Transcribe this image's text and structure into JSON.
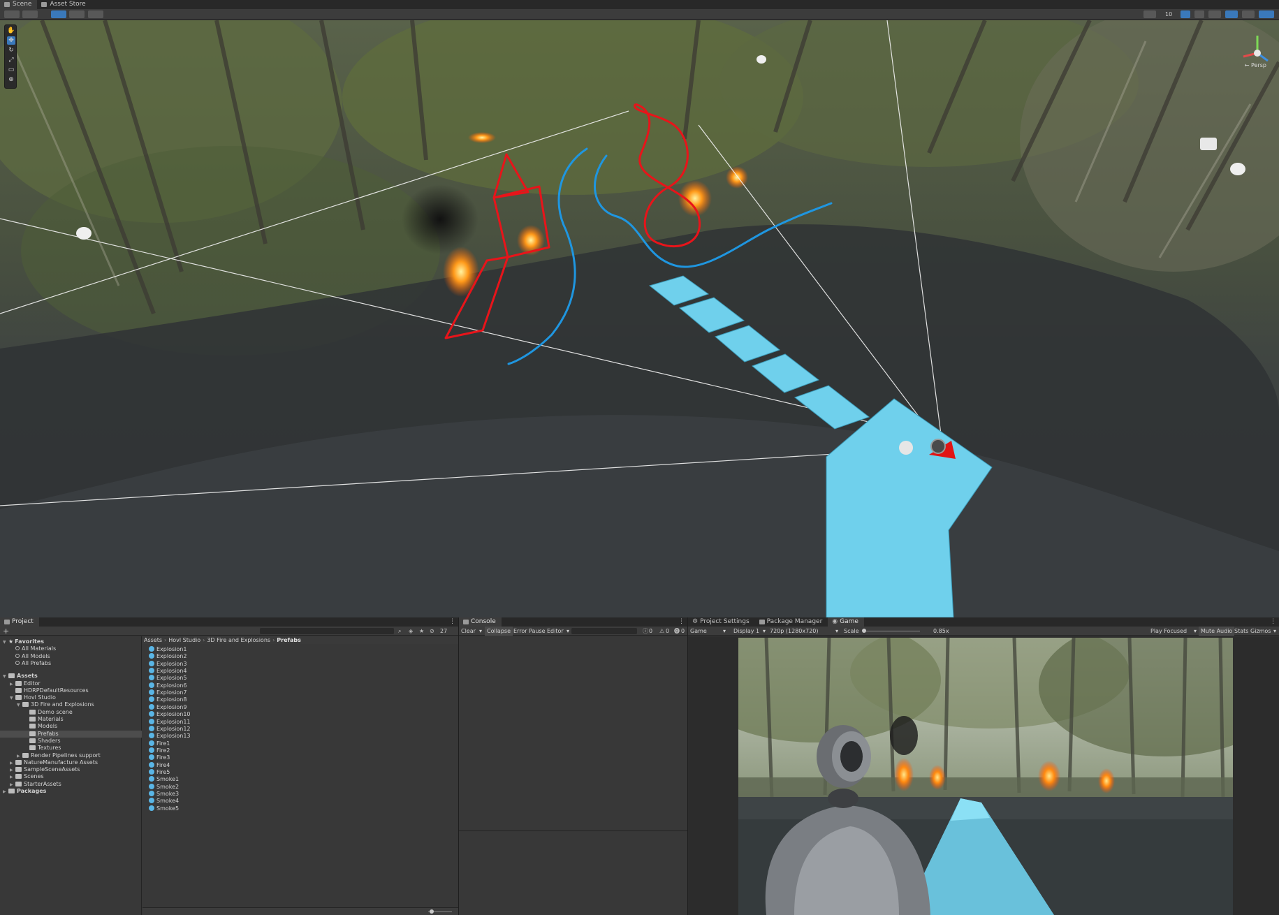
{
  "top_tabs": [
    {
      "label": "Scene",
      "icon": "scene-icon"
    },
    {
      "label": "Asset Store",
      "icon": "store-icon"
    }
  ],
  "scene": {
    "gizmo_label": "← Persp",
    "toolbar_number": "10"
  },
  "project": {
    "tab_label": "Project",
    "add_label": "+",
    "hidden_count": "27",
    "tree": [
      {
        "label": "Favorites",
        "level": 0,
        "bold": true,
        "kind": "star",
        "fold": "▼"
      },
      {
        "label": "All Materials",
        "level": 1,
        "kind": "search"
      },
      {
        "label": "All Models",
        "level": 1,
        "kind": "search"
      },
      {
        "label": "All Prefabs",
        "level": 1,
        "kind": "search"
      },
      {
        "label": "Assets",
        "level": 0,
        "bold": true,
        "kind": "folder",
        "fold": "▼",
        "gap": true
      },
      {
        "label": "Editor",
        "level": 1,
        "kind": "folder",
        "fold": "▶"
      },
      {
        "label": "HDRPDefaultResources",
        "level": 1,
        "kind": "folder"
      },
      {
        "label": "Hovl Studio",
        "level": 1,
        "kind": "folder",
        "fold": "▼"
      },
      {
        "label": "3D Fire and Explosions",
        "level": 2,
        "kind": "folder",
        "fold": "▼"
      },
      {
        "label": "Demo scene",
        "level": 3,
        "kind": "folder"
      },
      {
        "label": "Materials",
        "level": 3,
        "kind": "folder"
      },
      {
        "label": "Models",
        "level": 3,
        "kind": "folder"
      },
      {
        "label": "Prefabs",
        "level": 3,
        "kind": "folder",
        "selected": true
      },
      {
        "label": "Shaders",
        "level": 3,
        "kind": "folder"
      },
      {
        "label": "Textures",
        "level": 3,
        "kind": "folder"
      },
      {
        "label": "Render Pipelines support",
        "level": 2,
        "kind": "folder",
        "fold": "▶"
      },
      {
        "label": "NatureManufacture Assets",
        "level": 1,
        "kind": "folder",
        "fold": "▶"
      },
      {
        "label": "SampleSceneAssets",
        "level": 1,
        "kind": "folder",
        "fold": "▶"
      },
      {
        "label": "Scenes",
        "level": 1,
        "kind": "folder",
        "fold": "▶"
      },
      {
        "label": "StarterAssets",
        "level": 1,
        "kind": "folder",
        "fold": "▶"
      },
      {
        "label": "Packages",
        "level": 0,
        "bold": true,
        "kind": "folder",
        "fold": "▶"
      }
    ],
    "breadcrumb": [
      "Assets",
      "Hovl Studio",
      "3D Fire and Explosions",
      "Prefabs"
    ],
    "assets": [
      "Explosion1",
      "Explosion2",
      "Explosion3",
      "Explosion4",
      "Explosion5",
      "Explosion6",
      "Explosion7",
      "Explosion8",
      "Explosion9",
      "Explosion10",
      "Explosion11",
      "Explosion12",
      "Explosion13",
      "Fire1",
      "Fire2",
      "Fire3",
      "Fire4",
      "Fire5",
      "Smoke1",
      "Smoke2",
      "Smoke3",
      "Smoke4",
      "Smoke5"
    ]
  },
  "console": {
    "tab_label": "Console",
    "clear": "Clear",
    "collapse": "Collapse",
    "error_pause": "Error Pause",
    "editor": "Editor",
    "count_log": "0",
    "count_warn": "0",
    "count_error": "0"
  },
  "game": {
    "tabs": [
      "Project Settings",
      "Package Manager",
      "Game"
    ],
    "mode": "Game",
    "display": "Display 1",
    "resolution": "720p (1280x720)",
    "scale_label": "Scale",
    "scale_value": "0.85x",
    "play_focused": "Play Focused",
    "mute_audio": "Mute Audio",
    "stats": "Stats",
    "gizmos": "Gizmos"
  },
  "colors": {
    "accent": "#3a79bb",
    "platform": "#6fd0ec",
    "annotation_red": "#e8141a",
    "annotation_blue": "#1f96e0",
    "prefab": "#5ab6e6"
  }
}
